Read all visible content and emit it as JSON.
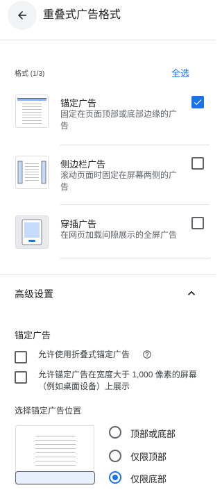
{
  "header": {
    "title": "重叠式广告格式",
    "back_icon": "arrow-back-icon"
  },
  "formats": {
    "section_label": "格式 (1/3)",
    "select_all": "全选",
    "items": [
      {
        "title": "锚定广告",
        "description": "固定在页面顶部或底部边缘的广告",
        "checked": true,
        "icon": "anchor-ad-thumbnail"
      },
      {
        "title": "侧边栏广告",
        "description": "滚动页面时固定在屏幕两侧的广告",
        "checked": false,
        "icon": "side-rail-ad-thumbnail"
      },
      {
        "title": "穿插广告",
        "description": "在网页加载间隙展示的全屏广告",
        "checked": false,
        "icon": "interstitial-ad-thumbnail"
      }
    ]
  },
  "advanced": {
    "title": "高级设置",
    "expanded": true,
    "anchor_section": {
      "title": "锚定广告",
      "options": [
        {
          "label": "允许使用折叠式锚定广告",
          "checked": false,
          "help_icon": true
        },
        {
          "label": "允许锚定广告在宽度大于 1,000 像素的屏幕（例如桌面设备）上展示",
          "checked": false
        }
      ],
      "position_title": "选择锚定广告位置",
      "positions": [
        {
          "label": "顶部或底部",
          "selected": false
        },
        {
          "label": "仅限顶部",
          "selected": false
        },
        {
          "label": "仅限底部",
          "selected": true
        }
      ]
    }
  },
  "colors": {
    "accent": "#1a73e8",
    "divider": "#e0e0e0",
    "text": "#202124",
    "secondary_text": "#5f6368",
    "preview_highlight": "#e8f0fe"
  }
}
